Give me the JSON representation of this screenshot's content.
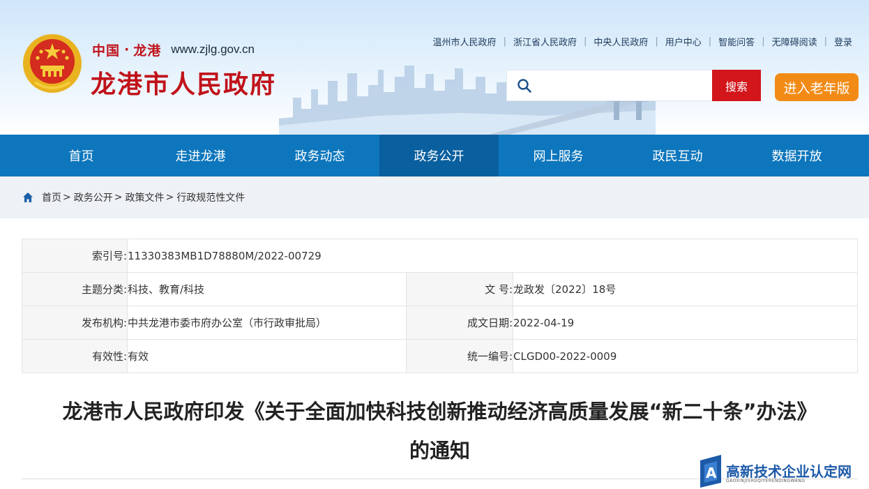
{
  "header": {
    "brand_prefix": "中国",
    "brand_dot": "·",
    "brand_city": "龙港",
    "url_text": "www.zjlg.gov.cn",
    "site_name": "龙港市人民政府",
    "top_links": [
      "温州市人民政府",
      "浙江省人民政府",
      "中央人民政府",
      "用户中心",
      "智能问答",
      "无障碍阅读",
      "登录"
    ],
    "search": {
      "placeholder": "",
      "button": "搜索"
    },
    "elder_button": "进入老年版"
  },
  "nav": {
    "items": [
      "首页",
      "走进龙港",
      "政务动态",
      "政务公开",
      "网上服务",
      "政民互动",
      "数据开放"
    ],
    "active": "政务公开"
  },
  "breadcrumb": [
    "首页",
    "政务公开",
    "政策文件",
    "行政规范性文件"
  ],
  "meta": {
    "index_label": "索引号:",
    "index_value": "11330383MB1D78880M/2022-00729",
    "topic_label": "主题分类:",
    "topic_value": "科技、教育/科技",
    "docno_label": "文 号:",
    "docno_value": "龙政发〔2022〕18号",
    "issuer_label": "发布机构:",
    "issuer_value": "中共龙港市委市府办公室（市行政审批局）",
    "date_label": "成文日期:",
    "date_value": "2022-04-19",
    "validity_label": "有效性:",
    "validity_value": "有效",
    "serial_label": "统一编号:",
    "serial_value": "CLGD00-2022-0009"
  },
  "title": {
    "line1": "龙港市人民政府印发《关于全面加快科技创新推动经济高质量发展“新二十条”办法》",
    "line2": "的通知"
  },
  "watermark": {
    "name": "高新技术企业认定网",
    "pinyin": "GAOXINJISHUQIYERENDINGWANG"
  },
  "colors": {
    "nav_blue": "#0d76bc",
    "nav_active": "#0a5f9e",
    "brand_red": "#c1121a",
    "search_red": "#d2161c",
    "elder_orange": "#f28b16"
  }
}
